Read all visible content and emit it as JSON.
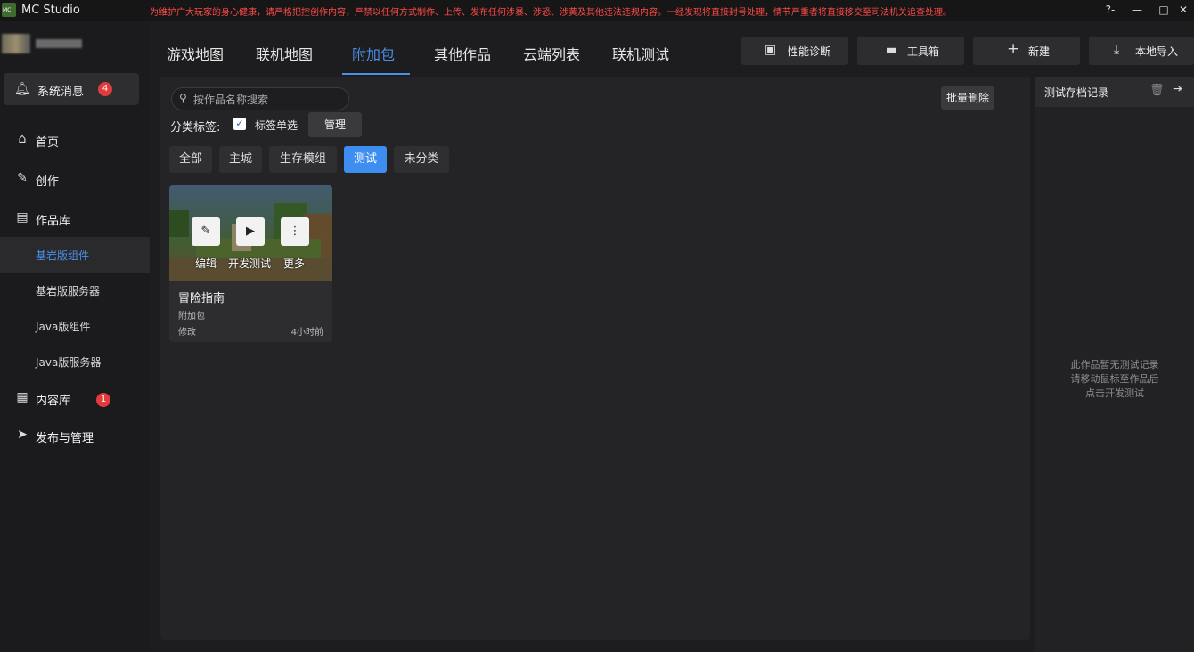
{
  "titlebar": {
    "app_title": "MC Studio",
    "notice": "为维护广大玩家的身心健康，请严格把控创作内容，严禁以任何方式制作、上传、发布任何涉暴、涉恐、涉黄及其他违法违规内容。一经发现将直接封号处理，情节严重者将直接移交至司法机关追查处理。",
    "help_icon": "?-",
    "minimize": "—",
    "maximize": "□",
    "close": "✕"
  },
  "sidebar": {
    "system_message": {
      "label": "系统消息",
      "badge": "4"
    },
    "nav": [
      {
        "id": "home",
        "label": "首页",
        "icon": "home-icon"
      },
      {
        "id": "create",
        "label": "创作",
        "icon": "pencil-icon"
      },
      {
        "id": "works",
        "label": "作品库",
        "icon": "chart-icon"
      }
    ],
    "sub_items": [
      "基岩版组件",
      "基岩版服务器",
      "Java版组件",
      "Java版服务器"
    ],
    "content_lib": {
      "label": "内容库",
      "badge": "1"
    },
    "publish": {
      "label": "发布与管理"
    }
  },
  "topnav": {
    "tabs": [
      "游戏地图",
      "联机地图",
      "附加包",
      "其他作品",
      "云端列表",
      "联机测试"
    ],
    "active_tab": "附加包",
    "buttons": {
      "perf": "性能诊断",
      "toolbox": "工具箱",
      "new": "新建",
      "import": "本地导入"
    }
  },
  "main": {
    "search_placeholder": "按作品名称搜索",
    "batch_delete": "批量删除",
    "category_label": "分类标签:",
    "single_select_label": "标签单选",
    "manage": "管理",
    "chips": [
      "全部",
      "主城",
      "生存模组",
      "测试",
      "未分类"
    ],
    "active_chip": "测试"
  },
  "card": {
    "title": "冒险指南",
    "type": "附加包",
    "modified_label": "修改",
    "time": "4小时前",
    "actions": {
      "edit": "编辑",
      "dev_test": "开发测试",
      "more": "更多"
    }
  },
  "right_panel": {
    "title": "测试存档记录",
    "empty": [
      "此作品暂无测试记录",
      "请移动鼠标至作品后",
      "点击开发测试"
    ]
  },
  "colors": {
    "accent": "#4a8fe8",
    "badge": "#e23b3b",
    "warning": "#ff4a4a"
  }
}
